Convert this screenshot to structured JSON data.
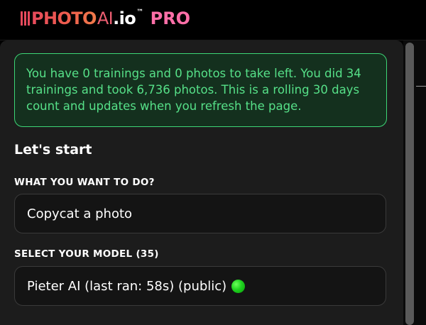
{
  "brand": {
    "photo_text": "PHOTO",
    "ai_text": "AI",
    "domain_text": ".io",
    "tm_text": "™",
    "pro_text": "PRO",
    "colors": {
      "photo": "#e74a5c",
      "ai": "#ec5e71",
      "pro": "#ff6fa8"
    }
  },
  "notice": {
    "text": "You have 0 trainings and 0 photos to take left. You did 34 trainings and took 6,736 photos. This is a rolling 30 days count and updates when you refresh the page.",
    "colors": {
      "text": "#56e088",
      "border": "#3dd676"
    }
  },
  "form": {
    "title": "Let's start",
    "action_label": "WHAT YOU WANT TO DO?",
    "action_value": "Copycat a photo",
    "model_label": "SELECT YOUR MODEL (35)",
    "model_value": "Pieter AI (last ran: 58s) (public)",
    "model_status_icon": "green-dot-icon",
    "model_status_color": "#1fd21f"
  }
}
